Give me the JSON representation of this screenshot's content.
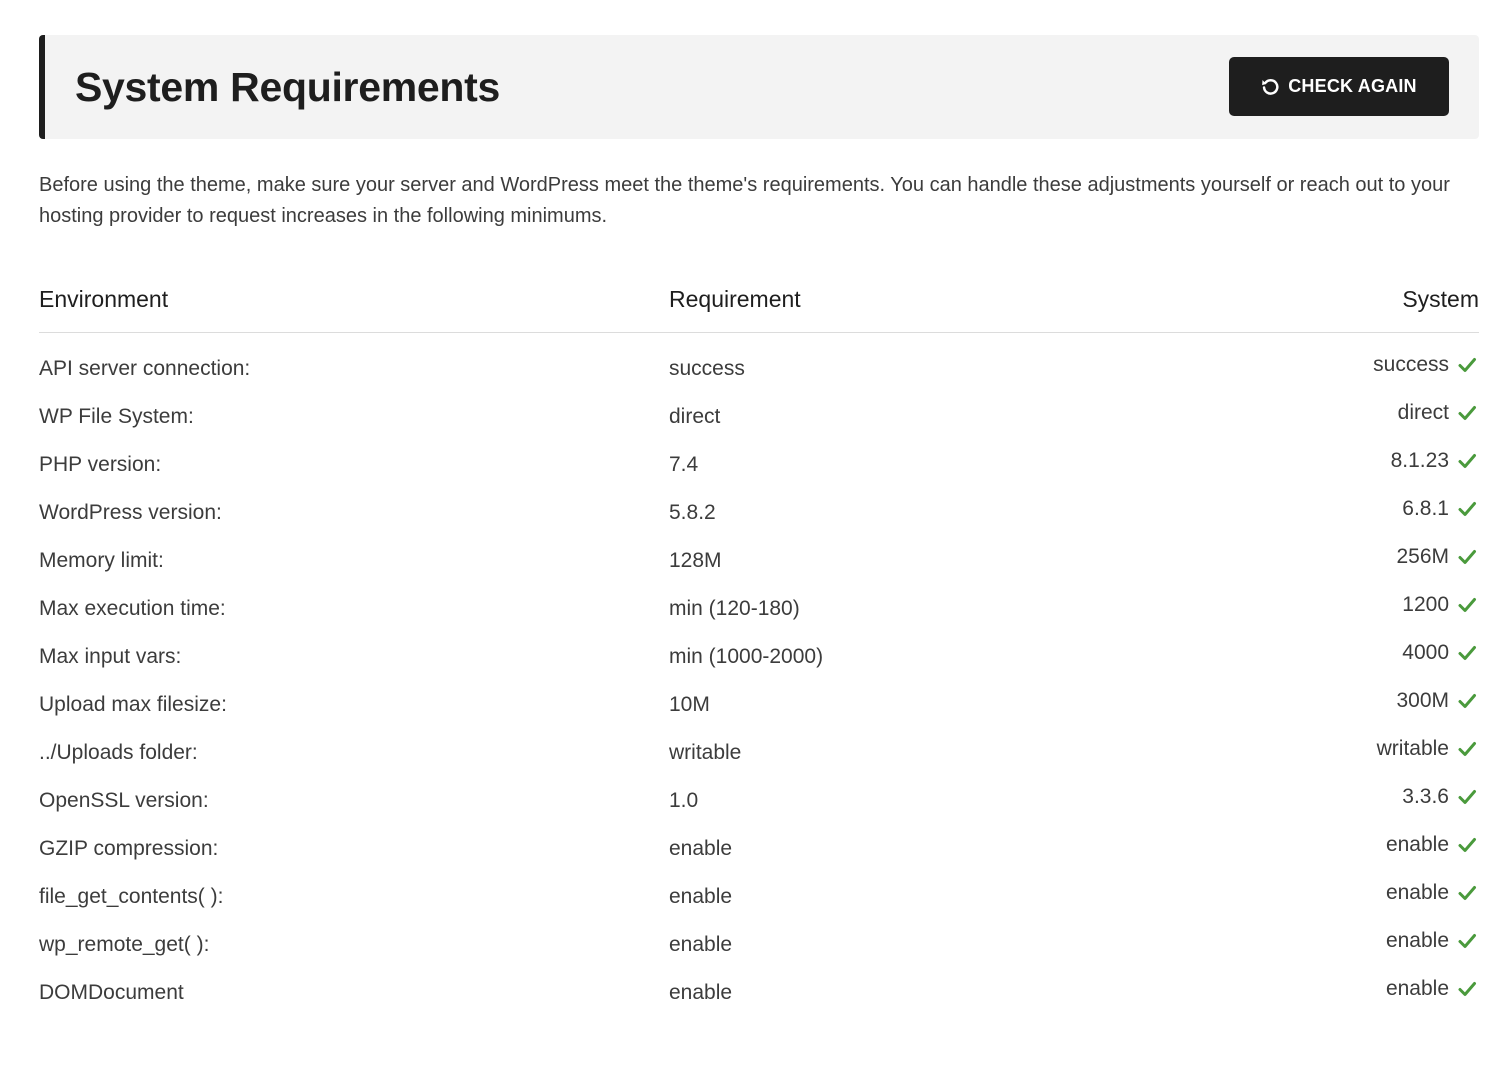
{
  "header": {
    "title": "System Requirements",
    "check_again_label": "CHECK AGAIN",
    "refresh_icon": "refresh-icon"
  },
  "intro": "Before using the theme, make sure your server and WordPress meet the theme's requirements. You can handle these adjustments yourself or reach out to your hosting provider to request increases in the following minimums.",
  "table": {
    "columns": {
      "environment": "Environment",
      "requirement": "Requirement",
      "system": "System"
    },
    "status_icon": "check-icon",
    "status_color": "#4a9a3c",
    "rows": [
      {
        "environment": "API server connection:",
        "requirement": "success",
        "system": "success"
      },
      {
        "environment": "WP File System:",
        "requirement": "direct",
        "system": "direct"
      },
      {
        "environment": "PHP version:",
        "requirement": "7.4",
        "system": "8.1.23"
      },
      {
        "environment": "WordPress version:",
        "requirement": "5.8.2",
        "system": "6.8.1"
      },
      {
        "environment": "Memory limit:",
        "requirement": "128M",
        "system": "256M"
      },
      {
        "environment": "Max execution time:",
        "requirement": "min (120-180)",
        "system": "1200"
      },
      {
        "environment": "Max input vars:",
        "requirement": "min (1000-2000)",
        "system": "4000"
      },
      {
        "environment": "Upload max filesize:",
        "requirement": "10M",
        "system": "300M"
      },
      {
        "environment": "../Uploads folder:",
        "requirement": "writable",
        "system": "writable"
      },
      {
        "environment": "OpenSSL version:",
        "requirement": "1.0",
        "system": "3.3.6"
      },
      {
        "environment": "GZIP compression:",
        "requirement": "enable",
        "system": "enable"
      },
      {
        "environment": "file_get_contents( ):",
        "requirement": "enable",
        "system": "enable"
      },
      {
        "environment": "wp_remote_get( ):",
        "requirement": "enable",
        "system": "enable"
      },
      {
        "environment": "DOMDocument",
        "requirement": "enable",
        "system": "enable"
      }
    ]
  }
}
